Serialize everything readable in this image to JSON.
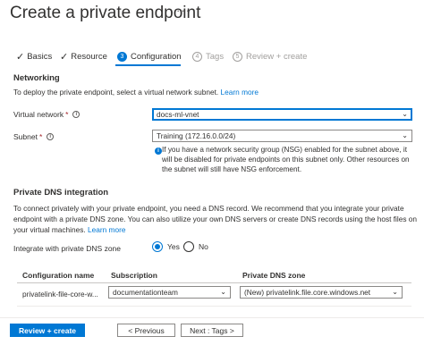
{
  "header": {
    "title": "Create a private endpoint",
    "more_label": "···"
  },
  "wizard": {
    "steps": [
      {
        "label": "Basics",
        "marker": "✓",
        "state": "completed"
      },
      {
        "label": "Resource",
        "marker": "✓",
        "state": "completed"
      },
      {
        "label": "Configuration",
        "marker": "3",
        "state": "active"
      },
      {
        "label": "Tags",
        "marker": "4",
        "state": "disabled"
      },
      {
        "label": "Review + create",
        "marker": "5",
        "state": "disabled"
      }
    ]
  },
  "networking": {
    "title": "Networking",
    "description": "To deploy the private endpoint, select a virtual network subnet.",
    "learn_more": "Learn more",
    "virtual_network": {
      "label": "Virtual network",
      "required_mark": "*",
      "value": "docs-ml-vnet"
    },
    "subnet": {
      "label": "Subnet",
      "required_mark": "*",
      "value": "Training (172.16.0.0/24)"
    },
    "subnet_info": "If you have a network security group (NSG) enabled for the subnet above, it will be disabled for private endpoints on this subnet only. Other resources on the subnet will still have NSG enforcement."
  },
  "dns": {
    "title": "Private DNS integration",
    "description": "To connect privately with your private endpoint, you need a DNS record. We recommend that you integrate your private endpoint with a private DNS zone. You can also utilize your own DNS servers or create DNS records using the host files on your virtual machines.",
    "learn_more": "Learn more",
    "integrate_label": "Integrate with private DNS zone",
    "options": [
      {
        "label": "Yes",
        "checked": true
      },
      {
        "label": "No",
        "checked": false
      }
    ],
    "table": {
      "headers": [
        "Configuration name",
        "Subscription",
        "Private DNS zone"
      ],
      "rows": [
        [
          "privatelink-file-core-w...",
          "documentationteam",
          "(New) privatelink.file.core.windows.net"
        ]
      ]
    }
  },
  "footer": {
    "review_create": "Review + create",
    "previous": "< Previous",
    "next": "Next : Tags >"
  },
  "colors": {
    "accent": "#0078d4",
    "required": "#a4262c",
    "text": "#323130"
  }
}
